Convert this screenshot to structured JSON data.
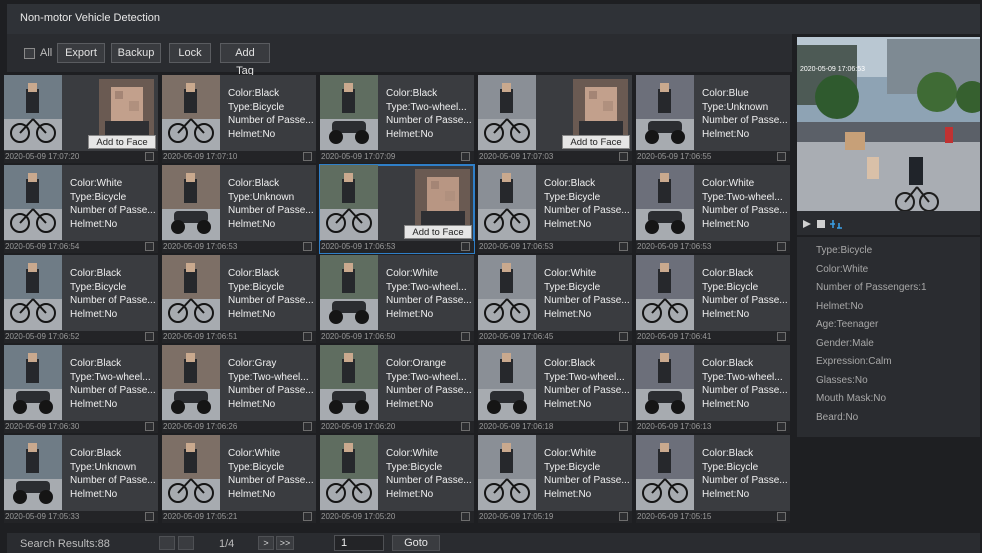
{
  "window": {
    "title": "Non-motor Vehicle Detection"
  },
  "toolbar": {
    "all_label": "All",
    "export_label": "Export",
    "backup_label": "Backup",
    "lock_label": "Lock",
    "add_tag_label": "Add Tag"
  },
  "add_to_face_label": "Add to Face D...",
  "rows": [
    [
      {
        "kind": "face",
        "timestamp": "2020-05-09 17:07:20",
        "selected": false
      },
      {
        "kind": "attrs",
        "color": "Color:Black",
        "type": "Type:Bicycle",
        "passengers": "Number of Passe...",
        "helmet": "Helmet:No",
        "timestamp": "2020-05-09 17:07:10"
      },
      {
        "kind": "attrs",
        "color": "Color:Black",
        "type": "Type:Two-wheel...",
        "passengers": "Number of Passe...",
        "helmet": "Helmet:No",
        "timestamp": "2020-05-09 17:07:09"
      },
      {
        "kind": "face",
        "timestamp": "2020-05-09 17:07:03",
        "selected": false
      },
      {
        "kind": "attrs",
        "color": "Color:Blue",
        "type": "Type:Unknown",
        "passengers": "Number of Passe...",
        "helmet": "Helmet:No",
        "timestamp": "2020-05-09 17:06:55"
      }
    ],
    [
      {
        "kind": "attrs",
        "color": "Color:White",
        "type": "Type:Bicycle",
        "passengers": "Number of Passe...",
        "helmet": "Helmet:No",
        "timestamp": "2020-05-09 17:06:54"
      },
      {
        "kind": "attrs",
        "color": "Color:Black",
        "type": "Type:Unknown",
        "passengers": "Number of Passe...",
        "helmet": "Helmet:No",
        "timestamp": "2020-05-09 17:06:53"
      },
      {
        "kind": "face",
        "timestamp": "2020-05-09 17:06:53",
        "selected": true
      },
      {
        "kind": "attrs",
        "color": "Color:Black",
        "type": "Type:Bicycle",
        "passengers": "Number of Passe...",
        "helmet": "Helmet:No",
        "timestamp": "2020-05-09 17:06:53"
      },
      {
        "kind": "attrs",
        "color": "Color:White",
        "type": "Type:Two-wheel...",
        "passengers": "Number of Passe...",
        "helmet": "Helmet:No",
        "timestamp": "2020-05-09 17:06:53"
      }
    ],
    [
      {
        "kind": "attrs",
        "color": "Color:Black",
        "type": "Type:Bicycle",
        "passengers": "Number of Passe...",
        "helmet": "Helmet:No",
        "timestamp": "2020-05-09 17:06:52"
      },
      {
        "kind": "attrs",
        "color": "Color:Black",
        "type": "Type:Bicycle",
        "passengers": "Number of Passe...",
        "helmet": "Helmet:No",
        "timestamp": "2020-05-09 17:06:51"
      },
      {
        "kind": "attrs",
        "color": "Color:White",
        "type": "Type:Two-wheel...",
        "passengers": "Number of Passe...",
        "helmet": "Helmet:No",
        "timestamp": "2020-05-09 17:06:50"
      },
      {
        "kind": "attrs",
        "color": "Color:White",
        "type": "Type:Bicycle",
        "passengers": "Number of Passe...",
        "helmet": "Helmet:No",
        "timestamp": "2020-05-09 17:06:45"
      },
      {
        "kind": "attrs",
        "color": "Color:Black",
        "type": "Type:Bicycle",
        "passengers": "Number of Passe...",
        "helmet": "Helmet:No",
        "timestamp": "2020-05-09 17:06:41"
      }
    ],
    [
      {
        "kind": "attrs",
        "color": "Color:Black",
        "type": "Type:Two-wheel...",
        "passengers": "Number of Passe...",
        "helmet": "Helmet:No",
        "timestamp": "2020-05-09 17:06:30"
      },
      {
        "kind": "attrs",
        "color": "Color:Gray",
        "type": "Type:Two-wheel...",
        "passengers": "Number of Passe...",
        "helmet": "Helmet:No",
        "timestamp": "2020-05-09 17:06:26"
      },
      {
        "kind": "attrs",
        "color": "Color:Orange",
        "type": "Type:Two-wheel...",
        "passengers": "Number of Passe...",
        "helmet": "Helmet:No",
        "timestamp": "2020-05-09 17:06:20"
      },
      {
        "kind": "attrs",
        "color": "Color:Black",
        "type": "Type:Two-wheel...",
        "passengers": "Number of Passe...",
        "helmet": "Helmet:No",
        "timestamp": "2020-05-09 17:06:18"
      },
      {
        "kind": "attrs",
        "color": "Color:Black",
        "type": "Type:Two-wheel...",
        "passengers": "Number of Passe...",
        "helmet": "Helmet:No",
        "timestamp": "2020-05-09 17:06:13"
      }
    ],
    [
      {
        "kind": "attrs",
        "color": "Color:Black",
        "type": "Type:Unknown",
        "passengers": "Number of Passe...",
        "helmet": "Helmet:No",
        "timestamp": "2020-05-09 17:05:33"
      },
      {
        "kind": "attrs",
        "color": "Color:White",
        "type": "Type:Bicycle",
        "passengers": "Number of Passe...",
        "helmet": "Helmet:No",
        "timestamp": "2020-05-09 17:05:21"
      },
      {
        "kind": "attrs",
        "color": "Color:White",
        "type": "Type:Bicycle",
        "passengers": "Number of Passe...",
        "helmet": "Helmet:No",
        "timestamp": "2020-05-09 17:05:20"
      },
      {
        "kind": "attrs",
        "color": "Color:White",
        "type": "Type:Bicycle",
        "passengers": "Number of Passe...",
        "helmet": "Helmet:No",
        "timestamp": "2020-05-09 17:05:19"
      },
      {
        "kind": "attrs",
        "color": "Color:Black",
        "type": "Type:Bicycle",
        "passengers": "Number of Passe...",
        "helmet": "Helmet:No",
        "timestamp": "2020-05-09 17:05:15"
      }
    ]
  ],
  "preview": {
    "video_timestamp": "2020-05-09 17:06:53"
  },
  "details": [
    "Type:Bicycle",
    "Color:White",
    "Number of Passengers:1",
    "Helmet:No",
    "Age:Teenager",
    "Gender:Male",
    "Expression:Calm",
    "Glasses:No",
    "Mouth Mask:No",
    "Beard:No"
  ],
  "footer": {
    "search_results": "Search Results:88",
    "page_indicator": "1/4",
    "next_label": ">",
    "last_label": ">>",
    "page_input_value": "1",
    "goto_label": "Goto"
  },
  "colors": {
    "selected_outline": "#2f7fc8",
    "panel_bg": "#3a3c40",
    "page_bg": "#1e1f22"
  }
}
